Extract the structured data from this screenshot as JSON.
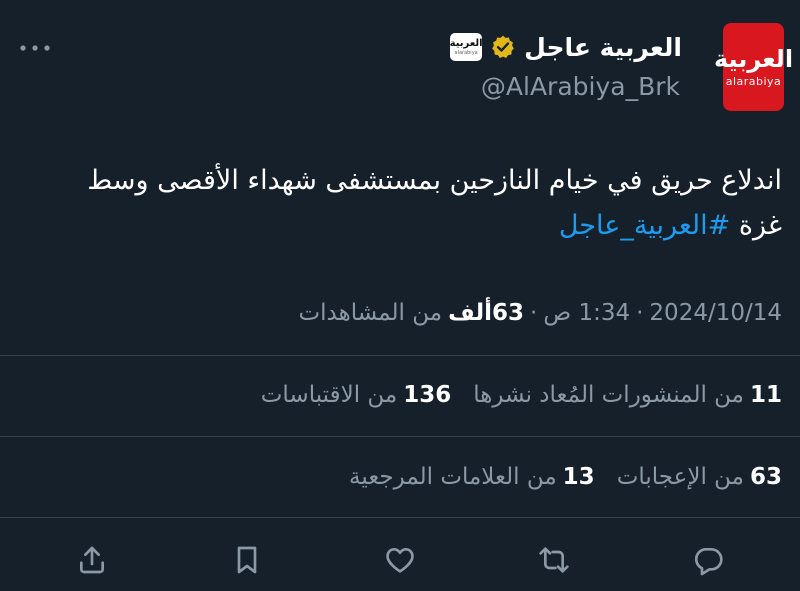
{
  "header": {
    "avatar_main": "العربية",
    "avatar_sub": "alarabiya",
    "display_name": "العربية عاجل",
    "affiliate_main": "العربية",
    "affiliate_sub": "alarabiya",
    "handle": "@AlArabiya_Brk"
  },
  "tweet": {
    "text": "اندلاع حريق في خيام النازحين بمستشفى شهداء الأقصى وسط غزة",
    "hashtag": "#العربية_عاجل"
  },
  "meta": {
    "date": "2024/10/14",
    "separator1": "·",
    "time": "1:34 ص",
    "separator2": "·",
    "views_count": "63ألف",
    "views_label": "من المشاهدات"
  },
  "stats_row1": {
    "reposts_count": "11",
    "reposts_label": "من المنشورات المُعاد نشرها",
    "quotes_count": "136",
    "quotes_label": "من الاقتباسات"
  },
  "stats_row2": {
    "likes_count": "63",
    "likes_label": "من الإعجابات",
    "bookmarks_count": "13",
    "bookmarks_label": "من العلامات المرجعية"
  },
  "colors": {
    "background": "#15202b",
    "text": "#ffffff",
    "secondary_text": "#8b98a5",
    "accent": "#1d9bf0",
    "verified": "#e2b719",
    "brand_red": "#d9171f",
    "divider": "#38444d"
  },
  "icons": {
    "more": "more-horizontal-icon",
    "verified": "verified-badge-icon",
    "share": "share-icon",
    "bookmark": "bookmark-icon",
    "like": "heart-icon",
    "repost": "repost-icon",
    "reply": "reply-icon"
  }
}
